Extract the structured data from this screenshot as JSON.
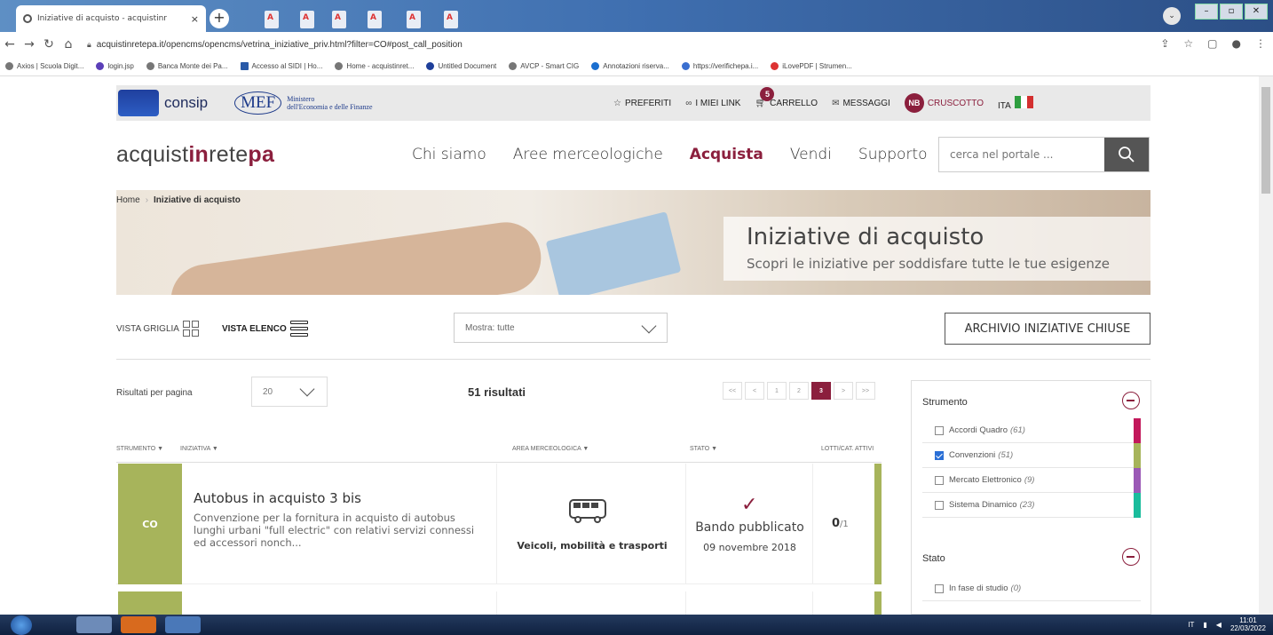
{
  "browser": {
    "tab_title": "Iniziative di acquisto - acquistinr",
    "tab_close": "×",
    "new_tab": "+",
    "url": "acquistinretepa.it/opencms/opencms/vetrina_iniziative_priv.html?filter=CO#post_call_position",
    "bookmarks": [
      "Axios | Scuola Digit...",
      "login.jsp",
      "Banca Monte dei Pa...",
      "Accesso al SIDI | Ho...",
      "Home - acquistinret...",
      "Untitled Document",
      "AVCP - Smart CIG",
      "Annotazioni riserva...",
      "https://verifichepa.i...",
      "iLovePDF | Strumen..."
    ]
  },
  "header": {
    "consip": "consip",
    "mef": "MEF",
    "mef_line1": "Ministero",
    "mef_line2": "dell'Economia e delle Finanze",
    "links": {
      "preferiti": "PREFERITI",
      "miei_link": "I MIEI LINK",
      "carrello": "CARRELLO",
      "cart_count": "5",
      "messaggi": "MESSAGGI",
      "user_initials": "NB",
      "cruscotto": "CRUSCOTTO",
      "lang": "ITA"
    }
  },
  "nav": {
    "brand_a": "acquist",
    "brand_b": "in",
    "brand_c": "rete",
    "brand_d": "pa",
    "items": [
      "Chi siamo",
      "Aree merceologiche",
      "Acquista",
      "Vendi",
      "Supporto"
    ],
    "search_placeholder": "cerca nel portale ..."
  },
  "hero": {
    "breadcrumb_home": "Home",
    "breadcrumb_current": "Iniziative di acquisto",
    "title": "Iniziative di acquisto",
    "subtitle": "Scopri le iniziative per soddisfare tutte le tue esigenze"
  },
  "toolbar": {
    "vista_griglia": "VISTA GRIGLIA",
    "vista_elenco": "VISTA ELENCO",
    "mostra": "Mostra: tutte",
    "archivio": "ARCHIVIO INIZIATIVE CHIUSE"
  },
  "results": {
    "per_page_label": "Risultati per pagina",
    "per_page_value": "20",
    "count": "51 risultati",
    "pager": [
      "<<",
      "<",
      "1",
      "2",
      "3",
      ">",
      ">>"
    ],
    "current_page": "3"
  },
  "columns": {
    "strumento": "STRUMENTO ▼",
    "iniziativa": "INIZIATIVA ▼",
    "area": "AREA MERCEOLOGICA ▼",
    "stato": "STATO ▼",
    "lotti": "LOTTI/CAT. ATTIVI"
  },
  "rows": [
    {
      "badge": "CO",
      "title": "Autobus in acquisto 3 bis",
      "description": "Convenzione per la fornitura in acquisto di autobus lunghi urbani \"full electric\" con relativi servizi connessi ed accessori nonch...",
      "area": "Veicoli, mobilità e trasporti",
      "stato": "Bando pubblicato",
      "data": "09 novembre 2018",
      "lotti": "0",
      "lotti_total": "/1",
      "check": "✓"
    }
  ],
  "filters": {
    "strumento_title": "Strumento",
    "strumento_items": [
      {
        "label": "Accordi Quadro",
        "count": "(61)",
        "checked": false,
        "color": "#c2185b"
      },
      {
        "label": "Convenzioni",
        "count": "(51)",
        "checked": true,
        "color": "#a7b45b"
      },
      {
        "label": "Mercato Elettronico",
        "count": "(9)",
        "checked": false,
        "color": "#9b59b6"
      },
      {
        "label": "Sistema Dinamico",
        "count": "(23)",
        "checked": false,
        "color": "#1abc9c"
      }
    ],
    "stato_title": "Stato",
    "stato_items": [
      {
        "label": "In fase di studio",
        "count": "(0)",
        "checked": false
      }
    ]
  },
  "taskbar": {
    "lang": "IT",
    "time": "11:01",
    "date": "22/03/2022"
  }
}
